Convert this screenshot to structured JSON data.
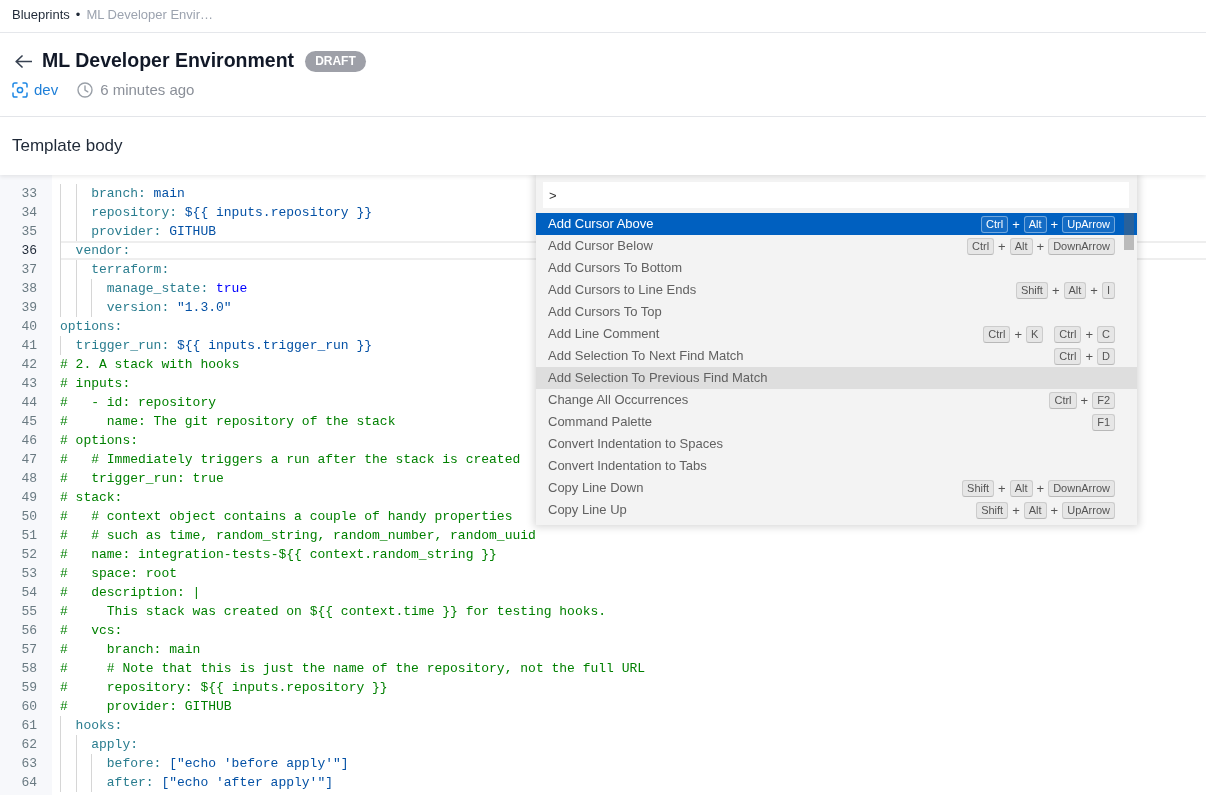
{
  "breadcrumb": {
    "items": [
      {
        "label": "Blueprints",
        "current": false
      },
      {
        "label": "ML Developer Envir…",
        "current": true
      }
    ],
    "separator": "•"
  },
  "header": {
    "title": "ML Developer Environment",
    "status": "DRAFT",
    "space": "dev",
    "updated": "6 minutes ago"
  },
  "section": {
    "title": "Template body"
  },
  "editor": {
    "lines": [
      {
        "number": "33",
        "current": false,
        "tokens": [
          {
            "kind": "key",
            "text": "    branch:"
          },
          {
            "kind": "value",
            "text": " main"
          }
        ]
      },
      {
        "number": "34",
        "current": false,
        "tokens": [
          {
            "kind": "key",
            "text": "    repository:"
          },
          {
            "kind": "value",
            "text": " ${{ inputs.repository }}"
          }
        ]
      },
      {
        "number": "35",
        "current": false,
        "tokens": [
          {
            "kind": "key",
            "text": "    provider:"
          },
          {
            "kind": "value",
            "text": " GITHUB"
          }
        ]
      },
      {
        "number": "36",
        "current": true,
        "tokens": [
          {
            "kind": "key",
            "text": "  vendor:"
          }
        ]
      },
      {
        "number": "37",
        "current": false,
        "tokens": [
          {
            "kind": "key",
            "text": "    terraform:"
          }
        ]
      },
      {
        "number": "38",
        "current": false,
        "tokens": [
          {
            "kind": "key",
            "text": "      manage_state:"
          },
          {
            "kind": "boolean",
            "text": " true"
          }
        ]
      },
      {
        "number": "39",
        "current": false,
        "tokens": [
          {
            "kind": "key",
            "text": "      version:"
          },
          {
            "kind": "string",
            "text": " \"1.3.0\""
          }
        ]
      },
      {
        "number": "40",
        "current": false,
        "tokens": [
          {
            "kind": "key",
            "text": "options:"
          }
        ]
      },
      {
        "number": "41",
        "current": false,
        "tokens": [
          {
            "kind": "key",
            "text": "  trigger_run:"
          },
          {
            "kind": "value",
            "text": " ${{ inputs.trigger_run }}"
          }
        ]
      },
      {
        "number": "42",
        "current": false,
        "tokens": [
          {
            "kind": "comment",
            "text": "# 2. A stack with hooks"
          }
        ]
      },
      {
        "number": "43",
        "current": false,
        "tokens": [
          {
            "kind": "comment",
            "text": "# inputs:"
          }
        ]
      },
      {
        "number": "44",
        "current": false,
        "tokens": [
          {
            "kind": "comment",
            "text": "#   - id: repository"
          }
        ]
      },
      {
        "number": "45",
        "current": false,
        "tokens": [
          {
            "kind": "comment",
            "text": "#     name: The git repository of the stack"
          }
        ]
      },
      {
        "number": "46",
        "current": false,
        "tokens": [
          {
            "kind": "comment",
            "text": "# options:"
          }
        ]
      },
      {
        "number": "47",
        "current": false,
        "tokens": [
          {
            "kind": "comment",
            "text": "#   # Immediately triggers a run after the stack is created"
          }
        ]
      },
      {
        "number": "48",
        "current": false,
        "tokens": [
          {
            "kind": "comment",
            "text": "#   trigger_run: true"
          }
        ]
      },
      {
        "number": "49",
        "current": false,
        "tokens": [
          {
            "kind": "comment",
            "text": "# stack:"
          }
        ]
      },
      {
        "number": "50",
        "current": false,
        "tokens": [
          {
            "kind": "comment",
            "text": "#   # context object contains a couple of handy properties"
          }
        ]
      },
      {
        "number": "51",
        "current": false,
        "tokens": [
          {
            "kind": "comment",
            "text": "#   # such as time, random_string, random_number, random_uuid"
          }
        ]
      },
      {
        "number": "52",
        "current": false,
        "tokens": [
          {
            "kind": "comment",
            "text": "#   name: integration-tests-${{ context.random_string }}"
          }
        ]
      },
      {
        "number": "53",
        "current": false,
        "tokens": [
          {
            "kind": "comment",
            "text": "#   space: root"
          }
        ]
      },
      {
        "number": "54",
        "current": false,
        "tokens": [
          {
            "kind": "comment",
            "text": "#   description: |"
          }
        ]
      },
      {
        "number": "55",
        "current": false,
        "tokens": [
          {
            "kind": "comment",
            "text": "#     This stack was created on ${{ context.time }} for testing hooks."
          }
        ]
      },
      {
        "number": "56",
        "current": false,
        "tokens": [
          {
            "kind": "comment",
            "text": "#   vcs:"
          }
        ]
      },
      {
        "number": "57",
        "current": false,
        "tokens": [
          {
            "kind": "comment",
            "text": "#     branch: main"
          }
        ]
      },
      {
        "number": "58",
        "current": false,
        "tokens": [
          {
            "kind": "comment",
            "text": "#     # Note that this is just the name of the repository, not the full URL"
          }
        ]
      },
      {
        "number": "59",
        "current": false,
        "tokens": [
          {
            "kind": "comment",
            "text": "#     repository: ${{ inputs.repository }}"
          }
        ]
      },
      {
        "number": "60",
        "current": false,
        "tokens": [
          {
            "kind": "comment",
            "text": "#     provider: GITHUB"
          }
        ]
      },
      {
        "number": "61",
        "current": false,
        "tokens": [
          {
            "kind": "key",
            "text": "  hooks:"
          }
        ]
      },
      {
        "number": "62",
        "current": false,
        "tokens": [
          {
            "kind": "key",
            "text": "    apply:"
          }
        ]
      },
      {
        "number": "63",
        "current": false,
        "tokens": [
          {
            "kind": "key",
            "text": "      before:"
          },
          {
            "kind": "value",
            "text": " [\"echo 'before apply'\"]"
          }
        ]
      },
      {
        "number": "64",
        "current": false,
        "tokens": [
          {
            "kind": "key",
            "text": "      after:"
          },
          {
            "kind": "value",
            "text": " [\"echo 'after apply'\"]"
          }
        ]
      }
    ],
    "command_palette": {
      "input": {
        "value": ">"
      },
      "items": [
        {
          "label": "Add Cursor Above",
          "selected": true,
          "hovered": false,
          "chords": [
            [
              {
                "kind": "key",
                "text": "Ctrl"
              },
              {
                "kind": "plus",
                "text": "+"
              },
              {
                "kind": "key",
                "text": "Alt"
              },
              {
                "kind": "plus",
                "text": "+"
              },
              {
                "kind": "key",
                "text": "UpArrow"
              }
            ]
          ]
        },
        {
          "label": "Add Cursor Below",
          "selected": false,
          "hovered": false,
          "chords": [
            [
              {
                "kind": "key",
                "text": "Ctrl"
              },
              {
                "kind": "plus",
                "text": "+"
              },
              {
                "kind": "key",
                "text": "Alt"
              },
              {
                "kind": "plus",
                "text": "+"
              },
              {
                "kind": "key",
                "text": "DownArrow"
              }
            ]
          ]
        },
        {
          "label": "Add Cursors To Bottom",
          "selected": false,
          "hovered": false
        },
        {
          "label": "Add Cursors to Line Ends",
          "selected": false,
          "hovered": false,
          "chords": [
            [
              {
                "kind": "key",
                "text": "Shift"
              },
              {
                "kind": "plus",
                "text": "+"
              },
              {
                "kind": "key",
                "text": "Alt"
              },
              {
                "kind": "plus",
                "text": "+"
              },
              {
                "kind": "key",
                "text": "I"
              }
            ]
          ]
        },
        {
          "label": "Add Cursors To Top",
          "selected": false,
          "hovered": false
        },
        {
          "label": "Add Line Comment",
          "selected": false,
          "hovered": false,
          "chords": [
            [
              {
                "kind": "key",
                "text": "Ctrl"
              },
              {
                "kind": "plus",
                "text": "+"
              },
              {
                "kind": "key",
                "text": "K"
              }
            ],
            [
              {
                "kind": "key",
                "text": "Ctrl"
              },
              {
                "kind": "plus",
                "text": "+"
              },
              {
                "kind": "key",
                "text": "C"
              }
            ]
          ]
        },
        {
          "label": "Add Selection To Next Find Match",
          "selected": false,
          "hovered": false,
          "chords": [
            [
              {
                "kind": "key",
                "text": "Ctrl"
              },
              {
                "kind": "plus",
                "text": "+"
              },
              {
                "kind": "key",
                "text": "D"
              }
            ]
          ]
        },
        {
          "label": "Add Selection To Previous Find Match",
          "selected": false,
          "hovered": true
        },
        {
          "label": "Change All Occurrences",
          "selected": false,
          "hovered": false,
          "chords": [
            [
              {
                "kind": "key",
                "text": "Ctrl"
              },
              {
                "kind": "plus",
                "text": "+"
              },
              {
                "kind": "key",
                "text": "F2"
              }
            ]
          ]
        },
        {
          "label": "Command Palette",
          "selected": false,
          "hovered": false,
          "chords": [
            [
              {
                "kind": "key",
                "text": "F1"
              }
            ]
          ]
        },
        {
          "label": "Convert Indentation to Spaces",
          "selected": false,
          "hovered": false
        },
        {
          "label": "Convert Indentation to Tabs",
          "selected": false,
          "hovered": false
        },
        {
          "label": "Copy Line Down",
          "selected": false,
          "hovered": false,
          "chords": [
            [
              {
                "kind": "key",
                "text": "Shift"
              },
              {
                "kind": "plus",
                "text": "+"
              },
              {
                "kind": "key",
                "text": "Alt"
              },
              {
                "kind": "plus",
                "text": "+"
              },
              {
                "kind": "key",
                "text": "DownArrow"
              }
            ]
          ]
        },
        {
          "label": "Copy Line Up",
          "selected": false,
          "hovered": false,
          "chords": [
            [
              {
                "kind": "key",
                "text": "Shift"
              },
              {
                "kind": "plus",
                "text": "+"
              },
              {
                "kind": "key",
                "text": "Alt"
              },
              {
                "kind": "plus",
                "text": "+"
              },
              {
                "kind": "key",
                "text": "UpArrow"
              }
            ]
          ]
        }
      ]
    }
  }
}
